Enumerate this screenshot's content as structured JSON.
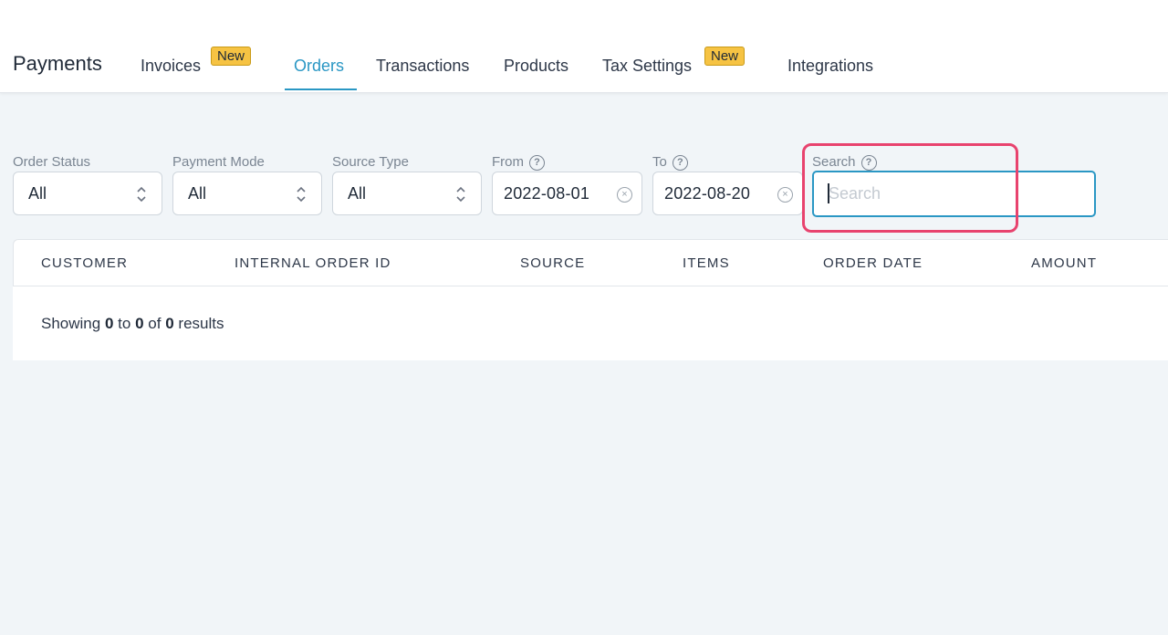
{
  "header": {
    "app_title": "Payments",
    "tabs": [
      {
        "label": "Invoices",
        "badge": "New"
      },
      {
        "label": "Orders",
        "active": true
      },
      {
        "label": "Transactions"
      },
      {
        "label": "Products"
      },
      {
        "label": "Tax Settings",
        "badge": "New"
      },
      {
        "label": "Integrations"
      }
    ]
  },
  "filters": {
    "order_status": {
      "label": "Order Status",
      "value": "All"
    },
    "payment_mode": {
      "label": "Payment Mode",
      "value": "All"
    },
    "source_type": {
      "label": "Source Type",
      "value": "All"
    },
    "from": {
      "label": "From",
      "value": "2022-08-01"
    },
    "to": {
      "label": "To",
      "value": "2022-08-20"
    },
    "search": {
      "label": "Search",
      "placeholder": "Search",
      "value": ""
    }
  },
  "table": {
    "columns": [
      "CUSTOMER",
      "INTERNAL ORDER ID",
      "SOURCE",
      "ITEMS",
      "ORDER DATE",
      "AMOUNT"
    ],
    "results": {
      "prefix": "Showing",
      "from": "0",
      "to_word": "to",
      "to": "0",
      "of_word": "of",
      "total": "0",
      "suffix": "results"
    }
  },
  "colors": {
    "accent": "#2a97c4",
    "badge": "#f6c343",
    "highlight": "#e8436e",
    "background": "#f1f5f8"
  }
}
